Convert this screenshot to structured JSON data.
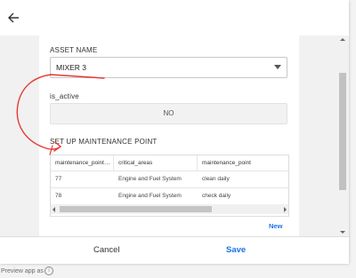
{
  "form": {
    "asset_name_label": "ASSET NAME",
    "asset_name_value": "MIXER 3",
    "is_active_label": "is_active",
    "is_active_value": "NO",
    "maintenance_section_label": "SET UP MAINTENANCE POINT"
  },
  "table": {
    "columns": [
      "maintenance_point_i...",
      "critical_areas",
      "maintenance_point"
    ],
    "rows": [
      [
        "77",
        "Engine and Fuel System",
        "clean daily"
      ],
      [
        "78",
        "Engine and Fuel System",
        "check daily"
      ]
    ],
    "new_label": "New"
  },
  "footer": {
    "cancel_label": "Cancel",
    "save_label": "Save"
  },
  "preview_text": "Preview app as",
  "icons": {
    "back": "arrow-left-icon",
    "info": "info-icon"
  },
  "colors": {
    "accent": "#1a73e8",
    "annotation": "#e53935"
  }
}
